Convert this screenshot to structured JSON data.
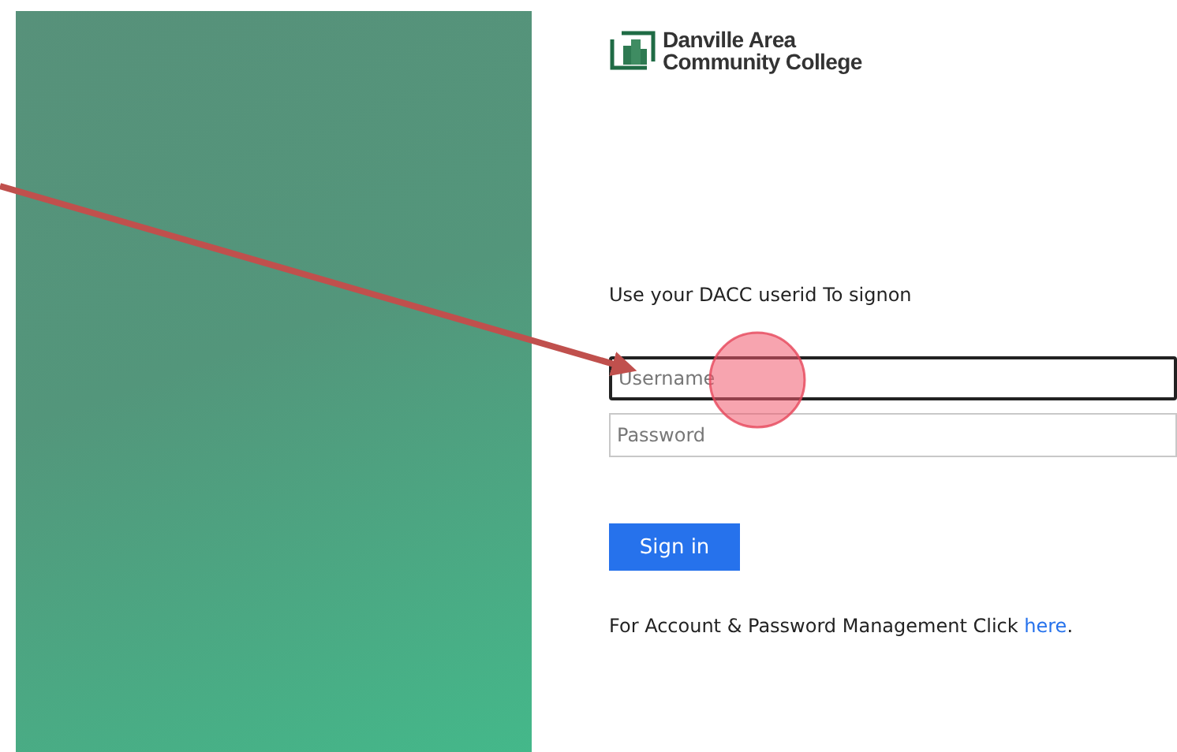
{
  "logo": {
    "line_1": "Danville Area",
    "line_2": "Community College"
  },
  "instruction": "Use your DACC userid To signon",
  "fields": [
    {
      "placeholder": "Username",
      "focused": true
    },
    {
      "placeholder": "Password",
      "focused": false
    }
  ],
  "button": "Sign in",
  "footer": {
    "text": "For Account & Password Management Click",
    "link": "here",
    "end": "."
  }
}
